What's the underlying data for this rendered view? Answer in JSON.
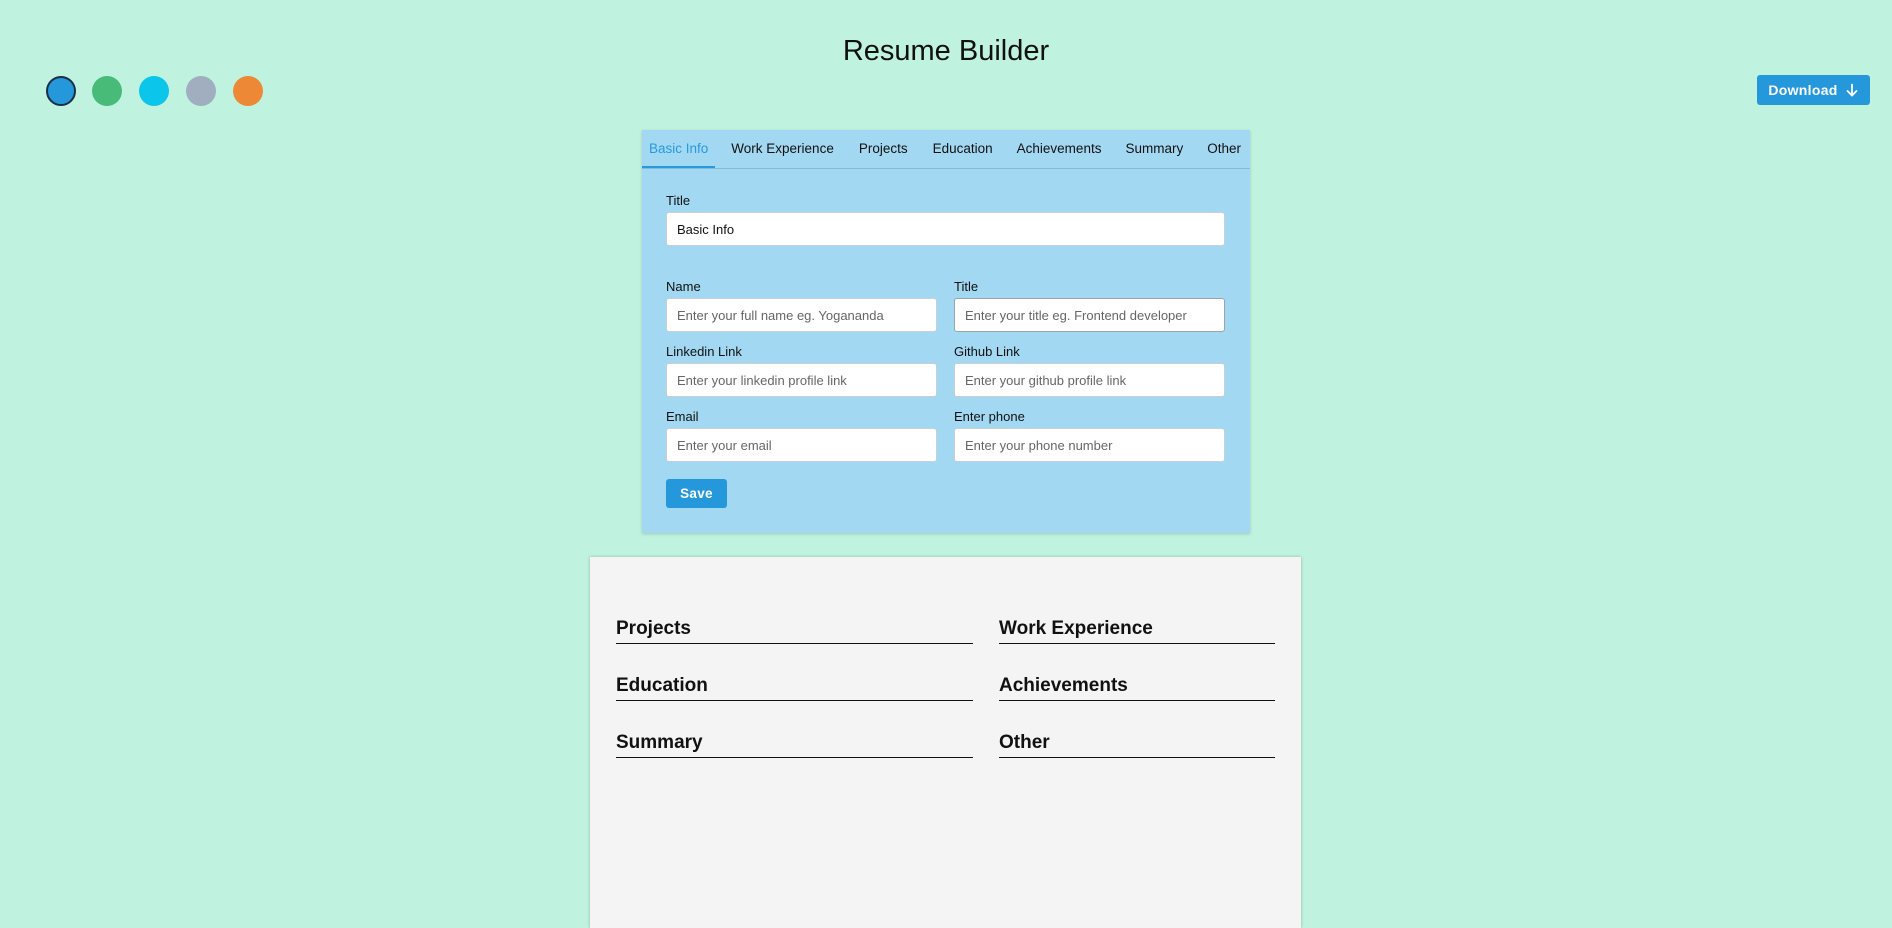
{
  "app": {
    "title": "Resume Builder"
  },
  "theme_colors": [
    {
      "name": "blue",
      "hex": "#2597db",
      "selected": true
    },
    {
      "name": "green",
      "hex": "#48bb78"
    },
    {
      "name": "cyan",
      "hex": "#0bc5ea"
    },
    {
      "name": "gray",
      "hex": "#a0aec0"
    },
    {
      "name": "orange",
      "hex": "#ed8936"
    }
  ],
  "toolbar": {
    "download_label": "Download",
    "download_icon": "arrow-down-icon",
    "accent_color": "#2597db"
  },
  "tabs": [
    {
      "label": "Basic Info",
      "active": true
    },
    {
      "label": "Work Experience"
    },
    {
      "label": "Projects"
    },
    {
      "label": "Education"
    },
    {
      "label": "Achievements"
    },
    {
      "label": "Summary"
    },
    {
      "label": "Other"
    }
  ],
  "form": {
    "section_title": {
      "label": "Title",
      "value": "Basic Info"
    },
    "fields": {
      "name": {
        "label": "Name",
        "placeholder": "Enter your full name eg. Yogananda",
        "value": ""
      },
      "title": {
        "label": "Title",
        "placeholder": "Enter your title eg. Frontend developer",
        "value": ""
      },
      "linkedin": {
        "label": "Linkedin Link",
        "placeholder": "Enter your linkedin profile link",
        "value": ""
      },
      "github": {
        "label": "Github Link",
        "placeholder": "Enter your github profile link",
        "value": ""
      },
      "email": {
        "label": "Email",
        "placeholder": "Enter your email",
        "value": ""
      },
      "phone": {
        "label": "Enter phone",
        "placeholder": "Enter your phone number",
        "value": ""
      }
    },
    "save_label": "Save"
  },
  "preview": {
    "sections": {
      "projects": "Projects",
      "work_experience": "Work Experience",
      "education": "Education",
      "achievements": "Achievements",
      "summary": "Summary",
      "other": "Other"
    }
  }
}
